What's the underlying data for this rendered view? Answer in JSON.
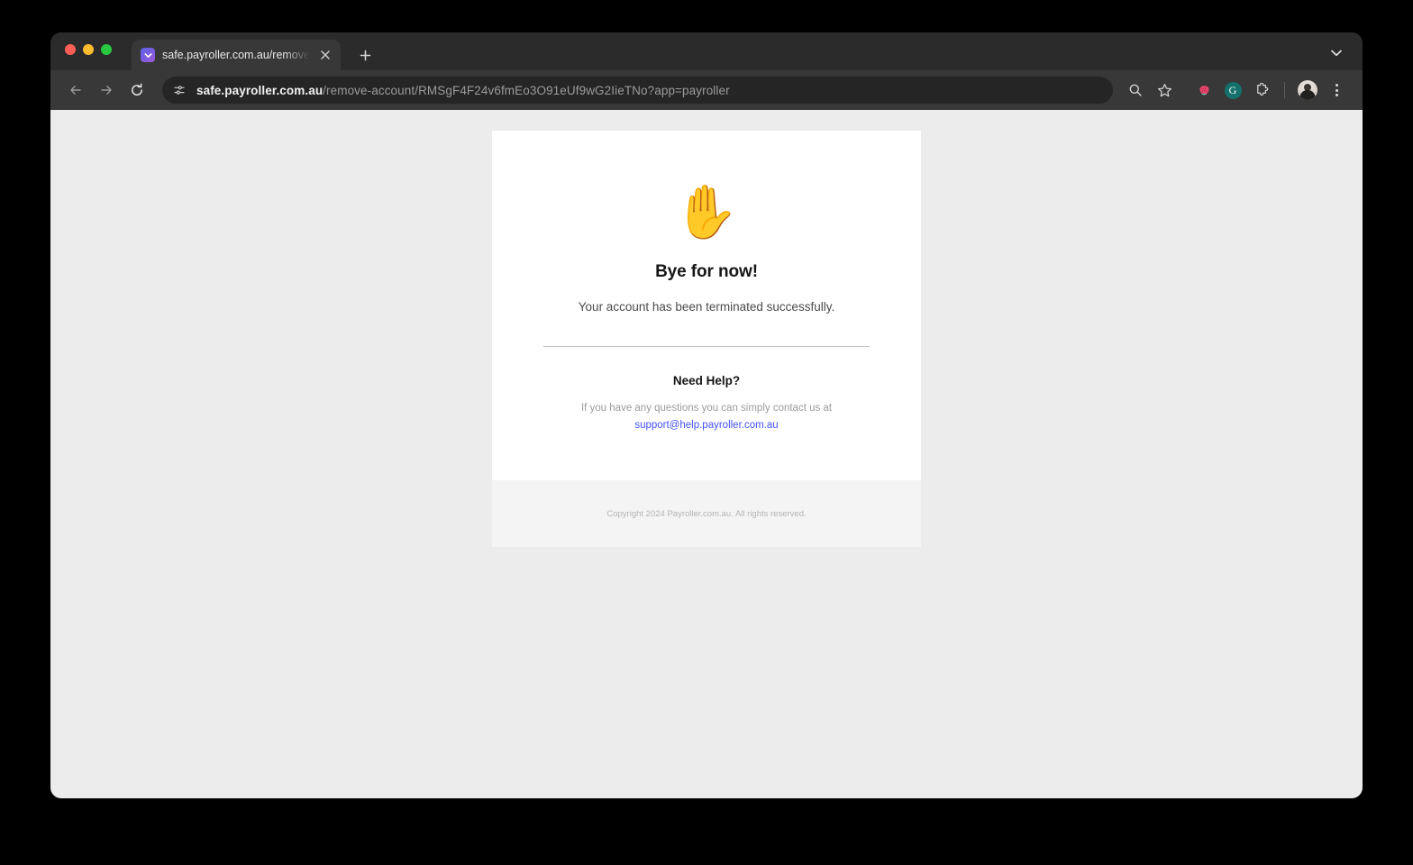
{
  "browser": {
    "tab": {
      "title": "safe.payroller.com.au/remove",
      "favicon_name": "payroller-favicon",
      "close_label": "✕"
    },
    "new_tab_label": "+",
    "tab_list_label": "⌄",
    "nav": {
      "back_label": "←",
      "forward_label": "→",
      "reload_label": "⟳"
    },
    "omnibox": {
      "site_info_icon": "site-settings-icon",
      "url_host": "safe.payroller.com.au",
      "url_path": "/remove-account/RMSgF4F24v6fmEo3O91eUf9wG2IieTNo?app=payroller"
    },
    "toolbar_icons": [
      {
        "name": "search-icon",
        "label": "⚲"
      },
      {
        "name": "bookmark-star-icon",
        "label": "☆"
      },
      {
        "name": "strawberry-extension-icon",
        "label": ""
      },
      {
        "name": "grammarly-extension-icon",
        "label": "G"
      },
      {
        "name": "extensions-puzzle-icon",
        "label": ""
      },
      {
        "name": "profile-avatar",
        "label": ""
      },
      {
        "name": "chrome-menu-icon",
        "label": ""
      }
    ],
    "colors": {
      "tab_strip": "#2b2b2b",
      "toolbar": "#383838",
      "omnibox": "#252525",
      "grammarly": "#15716b",
      "strawberry": "#e8446b"
    }
  },
  "page": {
    "background": "#ececec",
    "card": {
      "emoji": "✋",
      "emoji_name": "raised-hand-emoji",
      "headline": "Bye for now!",
      "subtext": "Your account has been terminated successfully.",
      "help_title": "Need Help?",
      "help_text": "If you have any questions you can simply contact us at",
      "help_email": "support@help.payroller.com.au",
      "link_color": "#4353ff"
    },
    "footer": {
      "copyright": "Copyright 2024 Payroller.com.au. All rights reserved."
    }
  }
}
